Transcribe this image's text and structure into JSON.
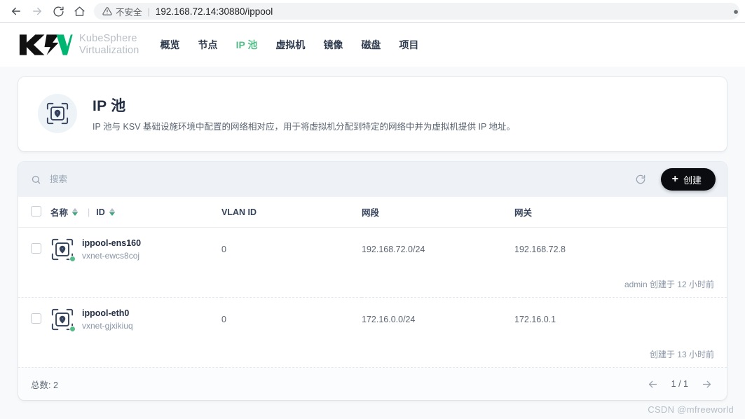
{
  "browser": {
    "back_label": "back-arrow",
    "forward_label": "forward-arrow",
    "reload_label": "reload",
    "home_label": "home",
    "security_label": "不安全",
    "url": "192.168.72.14:30880/ippool",
    "separator": "|"
  },
  "brand": {
    "logo_text": "KSV",
    "name_line1": "KubeSphere",
    "name_line2": "Virtualization",
    "accent_color": "#00b572"
  },
  "nav": {
    "items": [
      {
        "label": "概览",
        "active": false
      },
      {
        "label": "节点",
        "active": false
      },
      {
        "label": "IP 池",
        "active": true
      },
      {
        "label": "虚拟机",
        "active": false
      },
      {
        "label": "镜像",
        "active": false
      },
      {
        "label": "磁盘",
        "active": false
      },
      {
        "label": "项目",
        "active": false
      }
    ],
    "active_color": "#55bc8a"
  },
  "banner": {
    "title": "IP 池",
    "description": "IP 池与 KSV 基础设施环境中配置的网络相对应，用于将虚拟机分配到特定的网络中并为虚拟机提供 IP 地址。",
    "icon": "ip-pool-icon"
  },
  "toolbar": {
    "search_placeholder": "搜索",
    "search_value": "",
    "refresh_icon": "refresh-icon",
    "create_label": "创建",
    "create_plus": "+",
    "create_bg": "#0a0c10"
  },
  "table": {
    "columns": [
      {
        "key": "name",
        "label": "名称",
        "sortable": true
      },
      {
        "key": "id",
        "label": "ID",
        "sortable": true
      },
      {
        "key": "vlan",
        "label": "VLAN ID",
        "sortable": false
      },
      {
        "key": "cidr",
        "label": "网段",
        "sortable": false
      },
      {
        "key": "gateway",
        "label": "网关",
        "sortable": false
      }
    ],
    "column_divider": "|",
    "rows": [
      {
        "name": "ippool-ens160",
        "id": "vxnet-ewcs8coj",
        "vlan": "0",
        "cidr": "192.168.72.0/24",
        "gateway": "192.168.72.8",
        "status_color": "#55bc8a",
        "meta": "admin 创建于 12 小时前"
      },
      {
        "name": "ippool-eth0",
        "id": "vxnet-gjxikiuq",
        "vlan": "0",
        "cidr": "172.16.0.0/24",
        "gateway": "172.16.0.1",
        "status_color": "#55bc8a",
        "meta": "创建于 13 小时前"
      }
    ]
  },
  "footer": {
    "total_label": "总数: 2",
    "prev_icon": "arrow-left-icon",
    "next_icon": "arrow-right-icon",
    "page_indicator": "1 / 1"
  },
  "watermark": {
    "text": "CSDN @mfreeworld"
  }
}
